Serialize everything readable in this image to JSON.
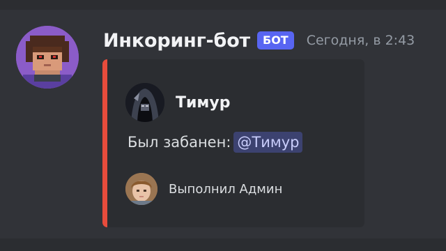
{
  "message": {
    "author": "Инкоринг-бот",
    "bot_tag": "БОТ",
    "timestamp": "Сегодня, в 2:43",
    "avatar_icon": "pixel-art-avatar-icon"
  },
  "embed": {
    "accent_color": "#e74c3c",
    "author": {
      "name": "Тимур",
      "avatar_icon": "dark-hooded-avatar-icon"
    },
    "description": {
      "text": "Был забанен:",
      "mention": "@Тимур"
    },
    "footer": {
      "text": "Выполнил Админ",
      "avatar_icon": "child-photo-avatar-icon"
    }
  }
}
